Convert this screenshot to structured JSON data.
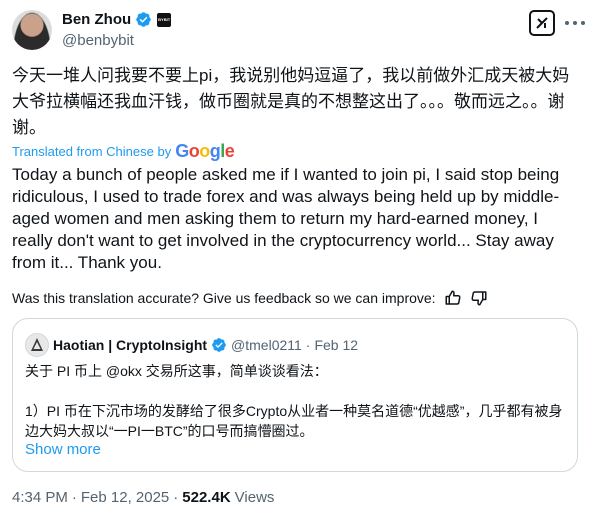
{
  "author": {
    "name": "Ben Zhou",
    "handle": "@benbybit",
    "affiliate_badge_text": "BYBIT"
  },
  "tweet": {
    "text_original": "今天一堆人问我要不要上pi，我说别他妈逗逼了，我以前做外汇成天被大妈大爷拉横幅还我血汗钱，做币圈就是真的不想整这出了。。。敬而远之。。谢谢。",
    "translated_from": "Translated from Chinese by",
    "google_logo": "Google",
    "translation": "Today a bunch of people asked me if I wanted to join pi, I said stop being ridiculous, I used to trade forex and was always being held up by middle-aged women and men asking them to return my hard-earned money, I really don't want to get involved in the cryptocurrency world... Stay away from it... Thank you.",
    "feedback_prompt": "Was this translation accurate? Give us feedback so we can improve:"
  },
  "quote": {
    "name": "Haotian | CryptoInsight",
    "handle": "@tmel0211",
    "separator": "·",
    "date": "Feb 12",
    "text": "关于 PI 币上 @okx 交易所这事，简单谈谈看法：\n\n1）PI 币在下沉市场的发酵给了很多Crypto从业者一种莫名道德“优越感”，几乎都有被身边大妈大叔以“一PI一BTC”的口号而搞懵圈过。",
    "show_more": "Show more"
  },
  "meta": {
    "time": "4:34 PM",
    "separator": "·",
    "date": "Feb 12, 2025",
    "views_count": "522.4K",
    "views_label": "Views"
  },
  "colors": {
    "accent": "#1d9bf0",
    "text": "#0f1419",
    "muted": "#536471",
    "border": "#cfd9de"
  },
  "icons": {
    "verified": "verified-badge-icon",
    "grok": "grok-icon",
    "more": "more-icon",
    "thumbs_up": "thumbs-up-icon",
    "thumbs_down": "thumbs-down-icon"
  }
}
